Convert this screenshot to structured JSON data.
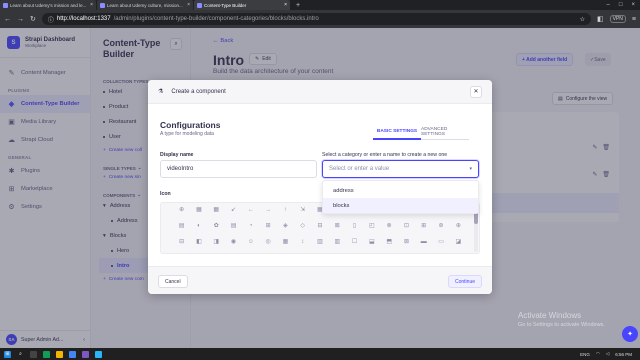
{
  "browser": {
    "tabs": [
      {
        "title": "Learn about Udemy's mission and le...",
        "active": false
      },
      {
        "title": "Learn about Udemy culture, mission...",
        "active": false
      },
      {
        "title": "Content-Type Builder",
        "active": true
      }
    ],
    "new_tab": "+",
    "url_host": "http://localhost:1337",
    "url_path": "/admin/plugins/content-type-builder/component-categories/blocks/blocks.intro",
    "vpn": "VPN"
  },
  "mainnav": {
    "brand_title": "Strapi Dashboard",
    "brand_sub": "Workplace",
    "top_items": [
      {
        "label": "Content Manager"
      }
    ],
    "plugins_heading": "PLUGINS",
    "plugin_items": [
      {
        "label": "Content-Type Builder",
        "active": true
      },
      {
        "label": "Media Library",
        "active": false
      },
      {
        "label": "Strapi Cloud",
        "active": false
      }
    ],
    "general_heading": "GENERAL",
    "general_items": [
      {
        "label": "Plugins"
      },
      {
        "label": "Marketplace"
      },
      {
        "label": "Settings"
      }
    ],
    "user_initials": "SA",
    "user_name": "Super Admin Ad..."
  },
  "subnav": {
    "title": "Content-Type Builder",
    "collection_heading": "COLLECTION TYPES",
    "collection_items": [
      "Hotel",
      "Product",
      "Restaurant",
      "User"
    ],
    "create_collection": "Create new coll",
    "single_heading": "SINGLE TYPES",
    "create_single": "Create new sin",
    "components_heading": "COMPONENTS",
    "groups": [
      {
        "name": "Address",
        "items": [
          "Address"
        ]
      },
      {
        "name": "Blocks",
        "items": [
          "Hero",
          "Intro"
        ]
      }
    ],
    "create_component": "Create new com"
  },
  "page": {
    "back": "Back",
    "title": "Intro",
    "edit": "Edit",
    "subtitle": "Build the data architecture of your content",
    "add_field": "+ Add another field",
    "save": "Save",
    "configure_view": "Configure the view"
  },
  "modal": {
    "header_title": "Create a component",
    "config_title": "Configurations",
    "config_sub": "A type for modeling data",
    "tab_basic": "BASIC SETTINGS",
    "tab_advanced": "ADVANCED SETTINGS",
    "display_name_label": "Display name",
    "display_name_value": "videoIntro",
    "category_label": "Select a category or enter a name to create a new one",
    "category_placeholder": "Select or enter a value",
    "options": [
      "address",
      "blocks"
    ],
    "icon_label": "Icon",
    "cancel": "Cancel",
    "continue": "Continue"
  },
  "watermark": {
    "line1": "Activate Windows",
    "line2": "Go to Settings to activate Windows."
  },
  "taskbar": {
    "lang": "ENG",
    "time": "6:56 PM"
  },
  "colors": {
    "primary": "#4945ff",
    "primary_light": "#f0f0ff"
  }
}
